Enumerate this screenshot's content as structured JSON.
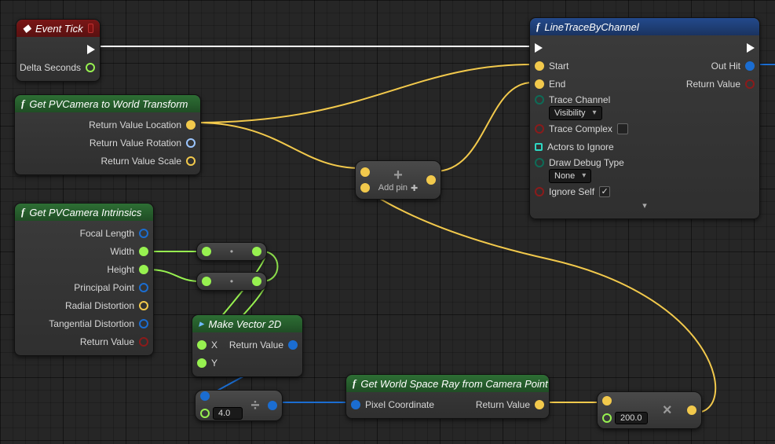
{
  "nodes": {
    "eventTick": {
      "title": "Event Tick",
      "outputs": {
        "deltaSeconds": "Delta Seconds"
      }
    },
    "pvCamTransform": {
      "title": "Get PVCamera to World Transform",
      "outputs": {
        "loc": "Return Value Location",
        "rot": "Return Value Rotation",
        "scale": "Return Value Scale"
      }
    },
    "pvCamIntrinsics": {
      "title": "Get PVCamera Intrinsics",
      "outputs": {
        "focal": "Focal Length",
        "width": "Width",
        "height": "Height",
        "pp": "Principal Point",
        "radial": "Radial Distortion",
        "tangential": "Tangential Distortion",
        "ret": "Return Value"
      }
    },
    "makeVec2d": {
      "title": "Make Vector 2D",
      "inputs": {
        "x": "X",
        "y": "Y"
      },
      "outputs": {
        "ret": "Return Value"
      }
    },
    "worldRay": {
      "title": "Get World Space Ray from Camera Point",
      "inputs": {
        "pixel": "Pixel Coordinate"
      },
      "outputs": {
        "ret": "Return Value"
      }
    },
    "lineTrace": {
      "title": "LineTraceByChannel",
      "inputs": {
        "start": "Start",
        "end": "End",
        "traceChannel": "Trace Channel",
        "traceComplex": "Trace Complex",
        "actorsIgnore": "Actors to Ignore",
        "drawDebug": "Draw Debug Type",
        "ignoreSelf": "Ignore Self"
      },
      "outputs": {
        "outHit": "Out Hit",
        "ret": "Return Value"
      },
      "values": {
        "traceChannel": "Visibility",
        "drawDebug": "None",
        "ignoreSelf": true,
        "traceComplex": false
      }
    },
    "addVec": {
      "addPin": "Add pin"
    },
    "divide": {
      "value": "4.0"
    },
    "multiply": {
      "value": "200.0"
    }
  }
}
